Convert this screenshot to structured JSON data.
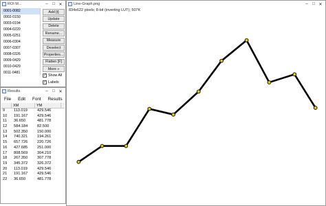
{
  "roi_window": {
    "title": "ROI M...",
    "controls": [
      "–",
      "□",
      "✕"
    ],
    "items": [
      "0001-0082",
      "0002-0150",
      "0003-0194",
      "0004-0220",
      "0005-0251",
      "0006-0304",
      "0007-0307",
      "0008-0326",
      "0009-0429",
      "0010-0429",
      "0011-0481"
    ],
    "buttons": [
      "Add [t]",
      "Update",
      "Delete",
      "Rename...",
      "Measure",
      "Deselect",
      "Properties...",
      "Flatten [F]",
      "More »"
    ],
    "checkboxes": [
      {
        "label": "Show All",
        "checked": true
      },
      {
        "label": "Labels",
        "checked": true
      }
    ]
  },
  "results_window": {
    "title": "Results",
    "controls": [
      "–",
      "□",
      "✕"
    ],
    "menu": [
      "File",
      "Edit",
      "Font",
      "Results"
    ],
    "columns": [
      "",
      "XM",
      "YM"
    ],
    "rows": [
      [
        "9",
        "113.019",
        "429.546"
      ],
      [
        "10",
        "191.167",
        "429.546"
      ],
      [
        "11",
        "36.650",
        "481.778"
      ],
      [
        "12",
        "584.184",
        "82.500"
      ],
      [
        "13",
        "502.350",
        "150.000"
      ],
      [
        "14",
        "740.321",
        "194.261"
      ],
      [
        "15",
        "657.726",
        "220.726"
      ],
      [
        "16",
        "427.685",
        "251.000"
      ],
      [
        "17",
        "808.569",
        "304.210"
      ],
      [
        "18",
        "267.350",
        "307.778"
      ],
      [
        "19",
        "345.372",
        "326.372"
      ],
      [
        "20",
        "113.019",
        "429.546"
      ],
      [
        "21",
        "191.167",
        "429.546"
      ],
      [
        "22",
        "36.650",
        "481.778"
      ]
    ]
  },
  "graph_window": {
    "title": "Line-Graph.png",
    "info": "834x622 pixels; 8-bit (inverting LUT); 507K",
    "controls": [
      "–",
      "□",
      "✕"
    ]
  },
  "chart_data": {
    "type": "line",
    "x": [
      36.65,
      113.019,
      191.167,
      267.35,
      345.372,
      427.685,
      502.35,
      584.184,
      657.726,
      740.321,
      808.569
    ],
    "y": [
      481.778,
      429.546,
      429.546,
      307.778,
      326.372,
      251.0,
      150.0,
      82.5,
      220.726,
      194.261,
      304.21
    ],
    "xlim": [
      0,
      834
    ],
    "ylim": [
      0,
      622
    ],
    "line_color": "#000000",
    "marker_color": "#e8c800",
    "title": "",
    "xlabel": "",
    "ylabel": ""
  }
}
